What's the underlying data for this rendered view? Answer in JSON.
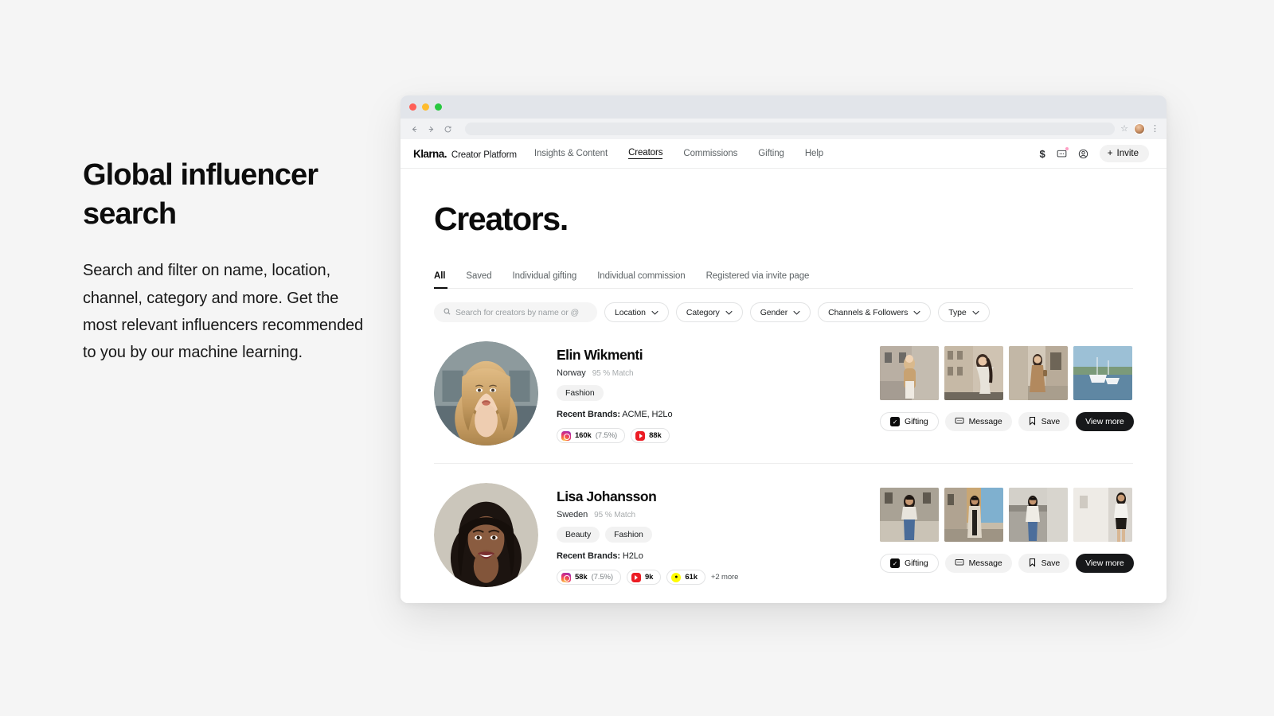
{
  "marketing": {
    "headline": "Global influencer search",
    "body": "Search and filter on name, location, channel, category and more. Get the most relevant influencers recommended to you by our machine learning."
  },
  "browser": {
    "traffic_lights": [
      "close",
      "minimize",
      "maximize"
    ],
    "back_icon": "back-arrow-icon",
    "forward_icon": "forward-arrow-icon",
    "reload_icon": "reload-icon",
    "url_value": "",
    "bookmark_icon": "star-icon",
    "profile_icon": "browser-avatar",
    "menu_icon": "kebab-menu-icon"
  },
  "appnav": {
    "brand": "Klarna.",
    "brand_sub": "Creator Platform",
    "links": [
      {
        "label": "Insights & Content",
        "active": false
      },
      {
        "label": "Creators",
        "active": true
      },
      {
        "label": "Commissions",
        "active": false
      },
      {
        "label": "Gifting",
        "active": false
      },
      {
        "label": "Help",
        "active": false
      }
    ],
    "right_icons": [
      {
        "name": "dollar-icon",
        "glyph": "$"
      },
      {
        "name": "message-icon",
        "glyph": "message"
      },
      {
        "name": "account-icon",
        "glyph": "account"
      }
    ],
    "invite_label": "Invite",
    "invite_plus": "+"
  },
  "page": {
    "title": "Creators.",
    "tabs": [
      {
        "label": "All",
        "active": true
      },
      {
        "label": "Saved",
        "active": false
      },
      {
        "label": "Individual gifting",
        "active": false
      },
      {
        "label": "Individual commission",
        "active": false
      },
      {
        "label": "Registered via invite page",
        "active": false
      }
    ],
    "search": {
      "placeholder": "Search for creators by name or @",
      "value": "",
      "icon": "search-icon"
    },
    "filters": [
      {
        "label": "Location"
      },
      {
        "label": "Category"
      },
      {
        "label": "Gender"
      },
      {
        "label": "Channels & Followers"
      },
      {
        "label": "Type"
      }
    ]
  },
  "creators": [
    {
      "name": "Elin Wikmenti",
      "country": "Norway",
      "match": "95 % Match",
      "tags": [
        "Fashion"
      ],
      "brands_label": "Recent Brands:",
      "brands_value": "ACME, H2Lo",
      "stats": [
        {
          "channel": "instagram",
          "count": "160k",
          "rate": "(7.5%)"
        },
        {
          "channel": "youtube",
          "count": "88k",
          "rate": ""
        }
      ],
      "more": "",
      "actions": {
        "gifting": "Gifting",
        "message": "Message",
        "save": "Save",
        "view_more": "View more"
      }
    },
    {
      "name": "Lisa Johansson",
      "country": "Sweden",
      "match": "95 % Match",
      "tags": [
        "Beauty",
        "Fashion"
      ],
      "brands_label": "Recent Brands:",
      "brands_value": "H2Lo",
      "stats": [
        {
          "channel": "instagram",
          "count": "58k",
          "rate": "(7.5%)"
        },
        {
          "channel": "youtube",
          "count": "9k",
          "rate": ""
        },
        {
          "channel": "snapchat",
          "count": "61k",
          "rate": ""
        }
      ],
      "more": "+2 more",
      "actions": {
        "gifting": "Gifting",
        "message": "Message",
        "save": "Save",
        "view_more": "View more"
      }
    }
  ],
  "colors": {
    "accent_dark": "#17181a",
    "page_bg": "#f5f5f5",
    "pill_border": "#e2e3e4",
    "muted_text": "#7b8084",
    "notification_dot": "#ff9ec4"
  }
}
